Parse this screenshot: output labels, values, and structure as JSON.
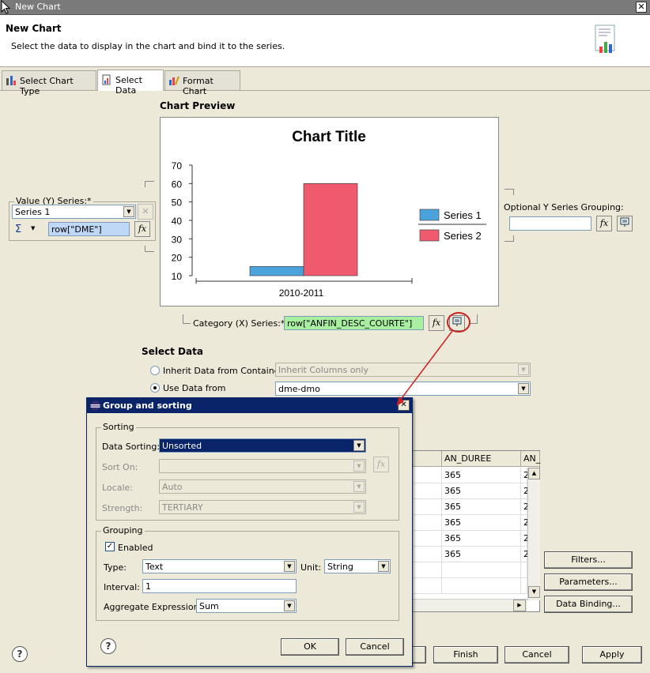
{
  "window": {
    "title": "New Chart"
  },
  "header": {
    "title": "New Chart",
    "subtitle": "Select the data to display in the chart and bind it to the series."
  },
  "tabs": [
    {
      "label": "Select Chart Type"
    },
    {
      "label": "Select Data"
    },
    {
      "label": "Format Chart"
    }
  ],
  "preview": {
    "section_label": "Chart Preview"
  },
  "chart_data": {
    "type": "bar",
    "title": "Chart Title",
    "categories": [
      "2010-2011"
    ],
    "series": [
      {
        "name": "Series 1",
        "values": [
          15
        ],
        "color": "#4ba3db"
      },
      {
        "name": "Series 2",
        "values": [
          60
        ],
        "color": "#f05a6e"
      }
    ],
    "yticks": [
      10,
      20,
      30,
      40,
      50,
      60,
      70
    ],
    "ylim": [
      10,
      70
    ],
    "legend": "right",
    "grid": false
  },
  "value_series": {
    "label": "Value (Y) Series:*",
    "selected": "Series 1",
    "expression": "row[\"DME\"]",
    "sigma": "Σ"
  },
  "optional_y": {
    "label": "Optional Y Series Grouping:",
    "value": ""
  },
  "category_series": {
    "label": "Category (X) Series:*",
    "expression": "row[\"ANFIN_DESC_COURTE\"]"
  },
  "select_data": {
    "section_label": "Select Data",
    "inherit_label": "Inherit Data from Container",
    "inherit_value": "Inherit Columns only",
    "use_label": "Use Data from",
    "use_value": "dme-dmo"
  },
  "grid": {
    "columns": [
      "AN_DUREE",
      "AN_"
    ],
    "rows": [
      [
        "365",
        "2"
      ],
      [
        "365",
        "2"
      ],
      [
        "365",
        "2"
      ],
      [
        "365",
        "2"
      ],
      [
        "365",
        "2"
      ],
      [
        "365",
        "2"
      ],
      [
        "",
        ""
      ],
      [
        "",
        ""
      ]
    ]
  },
  "side_buttons": {
    "filters": "Filters...",
    "parameters": "Parameters...",
    "binding": "Data Binding..."
  },
  "footer": {
    "finish": "Finish",
    "cancel": "Cancel",
    "apply": "Apply"
  },
  "dialog": {
    "title": "Group and sorting",
    "sorting": {
      "group_label": "Sorting",
      "data_sorting_label": "Data Sorting:",
      "data_sorting_value": "Unsorted",
      "sort_on_label": "Sort On:",
      "sort_on_value": "",
      "locale_label": "Locale:",
      "locale_value": "Auto",
      "strength_label": "Strength:",
      "strength_value": "TERTIARY"
    },
    "grouping": {
      "group_label": "Grouping",
      "enabled_label": "Enabled",
      "type_label": "Type:",
      "type_value": "Text",
      "unit_label": "Unit:",
      "unit_value": "String",
      "interval_label": "Interval:",
      "interval_value": "1",
      "aggregate_label": "Aggregate Expression:",
      "aggregate_value": "Sum"
    },
    "ok": "OK",
    "cancel": "Cancel"
  },
  "icons": {
    "help": "?",
    "fx": "fx",
    "close": "✕",
    "dropdown": "▼",
    "check": "✓"
  },
  "colors": {
    "dialog_title": "#0a246a",
    "highlight_circle": "#cc2222",
    "annotation_arrow": "#cc2222"
  }
}
